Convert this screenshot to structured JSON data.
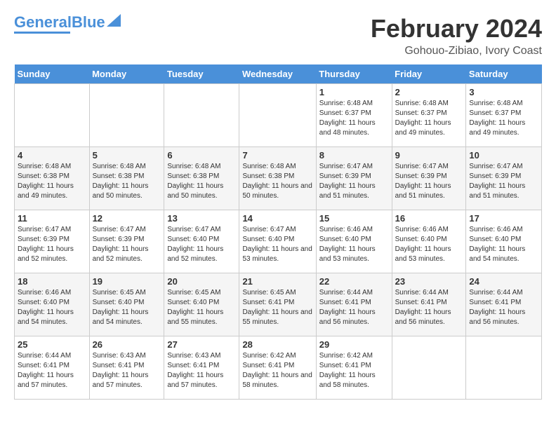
{
  "header": {
    "logo_general": "General",
    "logo_blue": "Blue",
    "main_title": "February 2024",
    "subtitle": "Gohouo-Zibiao, Ivory Coast"
  },
  "days_of_week": [
    "Sunday",
    "Monday",
    "Tuesday",
    "Wednesday",
    "Thursday",
    "Friday",
    "Saturday"
  ],
  "weeks": [
    [
      {
        "day": "",
        "info": ""
      },
      {
        "day": "",
        "info": ""
      },
      {
        "day": "",
        "info": ""
      },
      {
        "day": "",
        "info": ""
      },
      {
        "day": "1",
        "info": "Sunrise: 6:48 AM\nSunset: 6:37 PM\nDaylight: 11 hours and 48 minutes."
      },
      {
        "day": "2",
        "info": "Sunrise: 6:48 AM\nSunset: 6:37 PM\nDaylight: 11 hours and 49 minutes."
      },
      {
        "day": "3",
        "info": "Sunrise: 6:48 AM\nSunset: 6:37 PM\nDaylight: 11 hours and 49 minutes."
      }
    ],
    [
      {
        "day": "4",
        "info": "Sunrise: 6:48 AM\nSunset: 6:38 PM\nDaylight: 11 hours and 49 minutes."
      },
      {
        "day": "5",
        "info": "Sunrise: 6:48 AM\nSunset: 6:38 PM\nDaylight: 11 hours and 50 minutes."
      },
      {
        "day": "6",
        "info": "Sunrise: 6:48 AM\nSunset: 6:38 PM\nDaylight: 11 hours and 50 minutes."
      },
      {
        "day": "7",
        "info": "Sunrise: 6:48 AM\nSunset: 6:38 PM\nDaylight: 11 hours and 50 minutes."
      },
      {
        "day": "8",
        "info": "Sunrise: 6:47 AM\nSunset: 6:39 PM\nDaylight: 11 hours and 51 minutes."
      },
      {
        "day": "9",
        "info": "Sunrise: 6:47 AM\nSunset: 6:39 PM\nDaylight: 11 hours and 51 minutes."
      },
      {
        "day": "10",
        "info": "Sunrise: 6:47 AM\nSunset: 6:39 PM\nDaylight: 11 hours and 51 minutes."
      }
    ],
    [
      {
        "day": "11",
        "info": "Sunrise: 6:47 AM\nSunset: 6:39 PM\nDaylight: 11 hours and 52 minutes."
      },
      {
        "day": "12",
        "info": "Sunrise: 6:47 AM\nSunset: 6:39 PM\nDaylight: 11 hours and 52 minutes."
      },
      {
        "day": "13",
        "info": "Sunrise: 6:47 AM\nSunset: 6:40 PM\nDaylight: 11 hours and 52 minutes."
      },
      {
        "day": "14",
        "info": "Sunrise: 6:47 AM\nSunset: 6:40 PM\nDaylight: 11 hours and 53 minutes."
      },
      {
        "day": "15",
        "info": "Sunrise: 6:46 AM\nSunset: 6:40 PM\nDaylight: 11 hours and 53 minutes."
      },
      {
        "day": "16",
        "info": "Sunrise: 6:46 AM\nSunset: 6:40 PM\nDaylight: 11 hours and 53 minutes."
      },
      {
        "day": "17",
        "info": "Sunrise: 6:46 AM\nSunset: 6:40 PM\nDaylight: 11 hours and 54 minutes."
      }
    ],
    [
      {
        "day": "18",
        "info": "Sunrise: 6:46 AM\nSunset: 6:40 PM\nDaylight: 11 hours and 54 minutes."
      },
      {
        "day": "19",
        "info": "Sunrise: 6:45 AM\nSunset: 6:40 PM\nDaylight: 11 hours and 54 minutes."
      },
      {
        "day": "20",
        "info": "Sunrise: 6:45 AM\nSunset: 6:40 PM\nDaylight: 11 hours and 55 minutes."
      },
      {
        "day": "21",
        "info": "Sunrise: 6:45 AM\nSunset: 6:41 PM\nDaylight: 11 hours and 55 minutes."
      },
      {
        "day": "22",
        "info": "Sunrise: 6:44 AM\nSunset: 6:41 PM\nDaylight: 11 hours and 56 minutes."
      },
      {
        "day": "23",
        "info": "Sunrise: 6:44 AM\nSunset: 6:41 PM\nDaylight: 11 hours and 56 minutes."
      },
      {
        "day": "24",
        "info": "Sunrise: 6:44 AM\nSunset: 6:41 PM\nDaylight: 11 hours and 56 minutes."
      }
    ],
    [
      {
        "day": "25",
        "info": "Sunrise: 6:44 AM\nSunset: 6:41 PM\nDaylight: 11 hours and 57 minutes."
      },
      {
        "day": "26",
        "info": "Sunrise: 6:43 AM\nSunset: 6:41 PM\nDaylight: 11 hours and 57 minutes."
      },
      {
        "day": "27",
        "info": "Sunrise: 6:43 AM\nSunset: 6:41 PM\nDaylight: 11 hours and 57 minutes."
      },
      {
        "day": "28",
        "info": "Sunrise: 6:42 AM\nSunset: 6:41 PM\nDaylight: 11 hours and 58 minutes."
      },
      {
        "day": "29",
        "info": "Sunrise: 6:42 AM\nSunset: 6:41 PM\nDaylight: 11 hours and 58 minutes."
      },
      {
        "day": "",
        "info": ""
      },
      {
        "day": "",
        "info": ""
      }
    ]
  ]
}
